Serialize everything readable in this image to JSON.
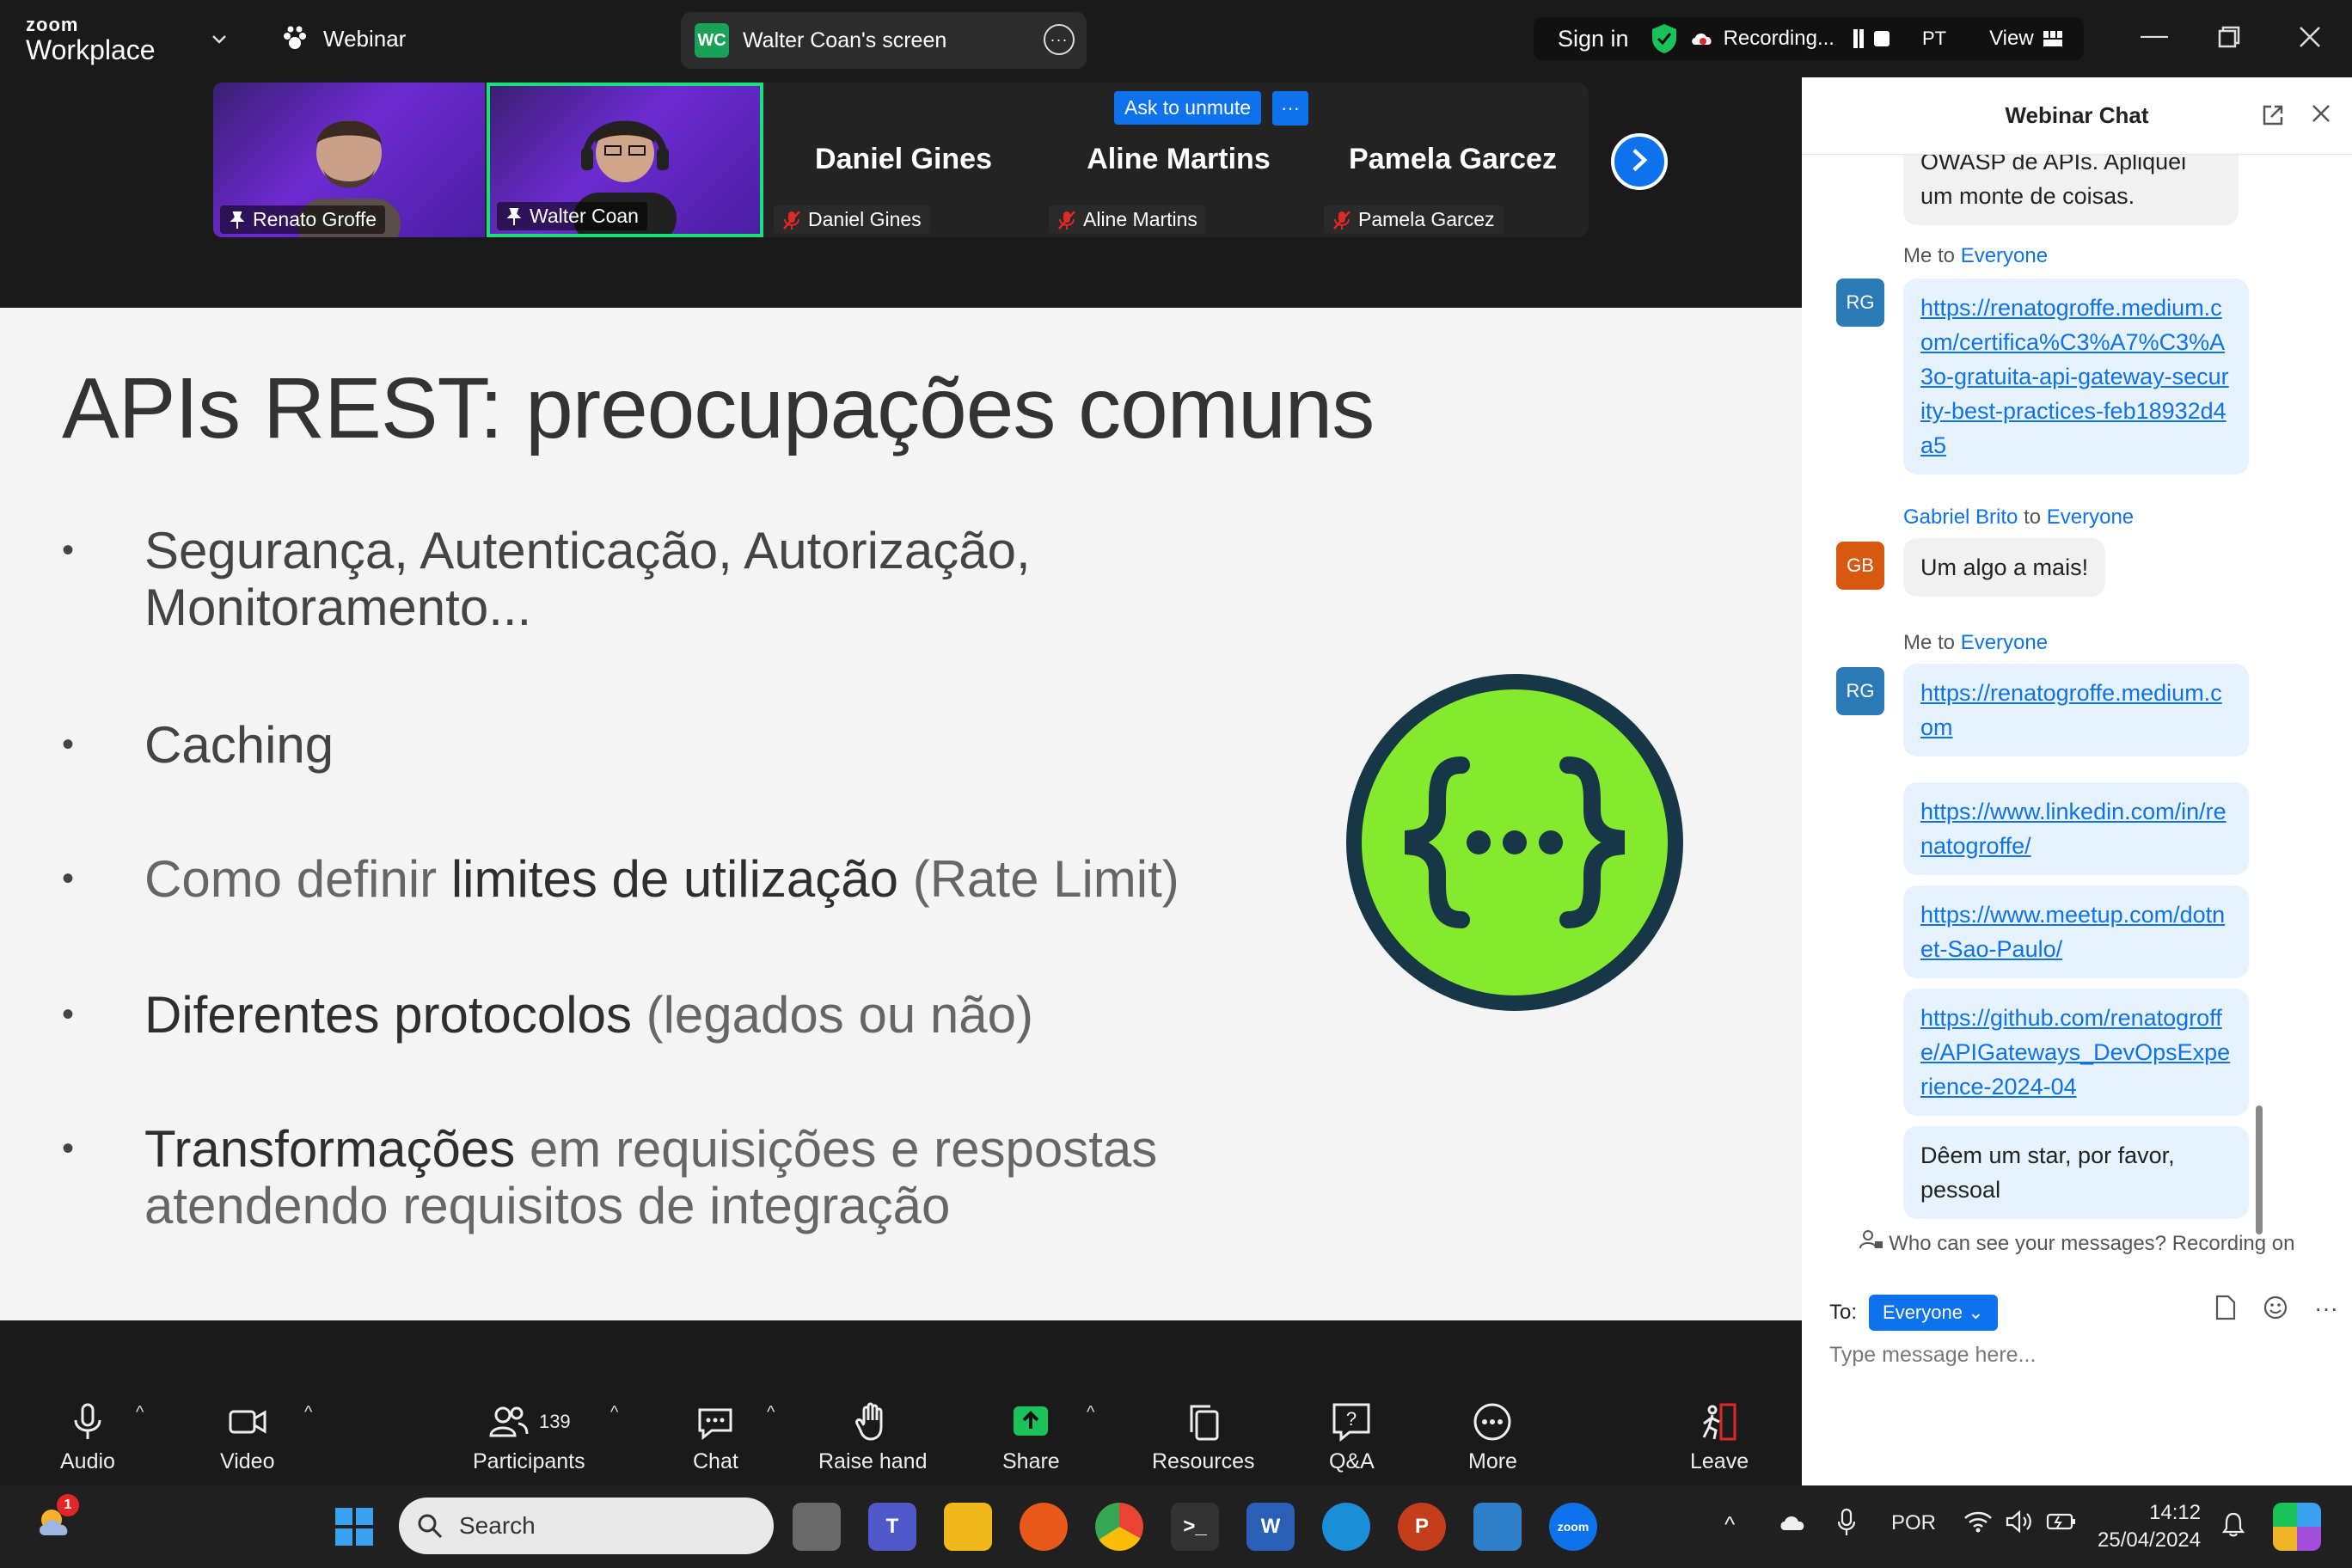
{
  "app": {
    "logo_line1": "zoom",
    "logo_line2": "Workplace",
    "mode": "Webinar",
    "screen_badge": "WC",
    "screen_title": "Walter Coan's screen",
    "sign_in": "Sign in",
    "recording": "Recording...",
    "language": "PT",
    "view": "View"
  },
  "videostrip": {
    "tiles": [
      {
        "name": "Renato Groffe",
        "type": "video"
      },
      {
        "name": "Walter Coan",
        "type": "video",
        "active": true
      },
      {
        "name": "Daniel Gines",
        "big": "Daniel Gines",
        "type": "name"
      },
      {
        "name": "Aline Martins",
        "big": "Aline Martins",
        "type": "name"
      },
      {
        "name": "Pamela Garcez",
        "big": "Pamela Garcez",
        "type": "name"
      }
    ],
    "ask_unmute": "Ask to unmute",
    "more": "···"
  },
  "slide": {
    "title": "APIs REST: preocupações comuns",
    "bullets": [
      {
        "line1": "Segurança, Autenticação, Autorização,",
        "line2": "Monitoramento..."
      },
      {
        "line1": "Caching"
      },
      {
        "pre": "Como definir ",
        "hl": "limites de utilização",
        "post": " (Rate Limit)"
      },
      {
        "hl": "Diferentes protocolos",
        "post": " (legados ou não)"
      },
      {
        "hl": "Transformações",
        "post": " em requisições e respostas",
        "line2": "atendendo requisitos de integração"
      }
    ]
  },
  "toolbar": {
    "audio": "Audio",
    "video": "Video",
    "participants": "Participants",
    "participants_count": "139",
    "chat": "Chat",
    "raise_hand": "Raise hand",
    "share": "Share",
    "resources": "Resources",
    "qa": "Q&A",
    "more": "More",
    "leave": "Leave"
  },
  "chat": {
    "title": "Webinar Chat",
    "partial_top": "OWASP de APIs. Apliquei",
    "partial_top2": "um monte de coisas.",
    "messages": [
      {
        "from": "Me",
        "to": "Everyone",
        "avatar": "RG",
        "text": "https://renatogroffe.medium.com/certifica%C3%A7%C3%A3o-gratuita-api-gateway-security-best-practices-feb18932d4a5"
      },
      {
        "from": "Gabriel Brito",
        "to": "Everyone",
        "avatar": "GB",
        "text": "Um algo a mais!"
      },
      {
        "from": "Me",
        "to": "Everyone",
        "avatar": "RG",
        "text": "https://renatogroffe.medium.com"
      },
      {
        "text": "https://www.linkedin.com/in/renatogroffe/"
      },
      {
        "text": "https://www.meetup.com/dotnet-Sao-Paulo/"
      },
      {
        "text": "https://github.com/renatogroffe/APIGateways_DevOpsExperience-2024-04"
      },
      {
        "text": "Dêem um star, por favor, pessoal"
      }
    ],
    "to_word": "to",
    "notice": "Who can see your messages? Recording on",
    "to_label": "To:",
    "to_value": "Everyone",
    "placeholder": "Type message here..."
  },
  "taskbar": {
    "search": "Search",
    "lang": "POR",
    "time": "14:12",
    "date": "25/04/2024",
    "weather_badge": "1"
  },
  "colors": {
    "accent": "#0e72ed",
    "share_green": "#19c35a",
    "api_green": "#85ea2d",
    "api_dark": "#173647",
    "rec_red": "#e02828"
  }
}
